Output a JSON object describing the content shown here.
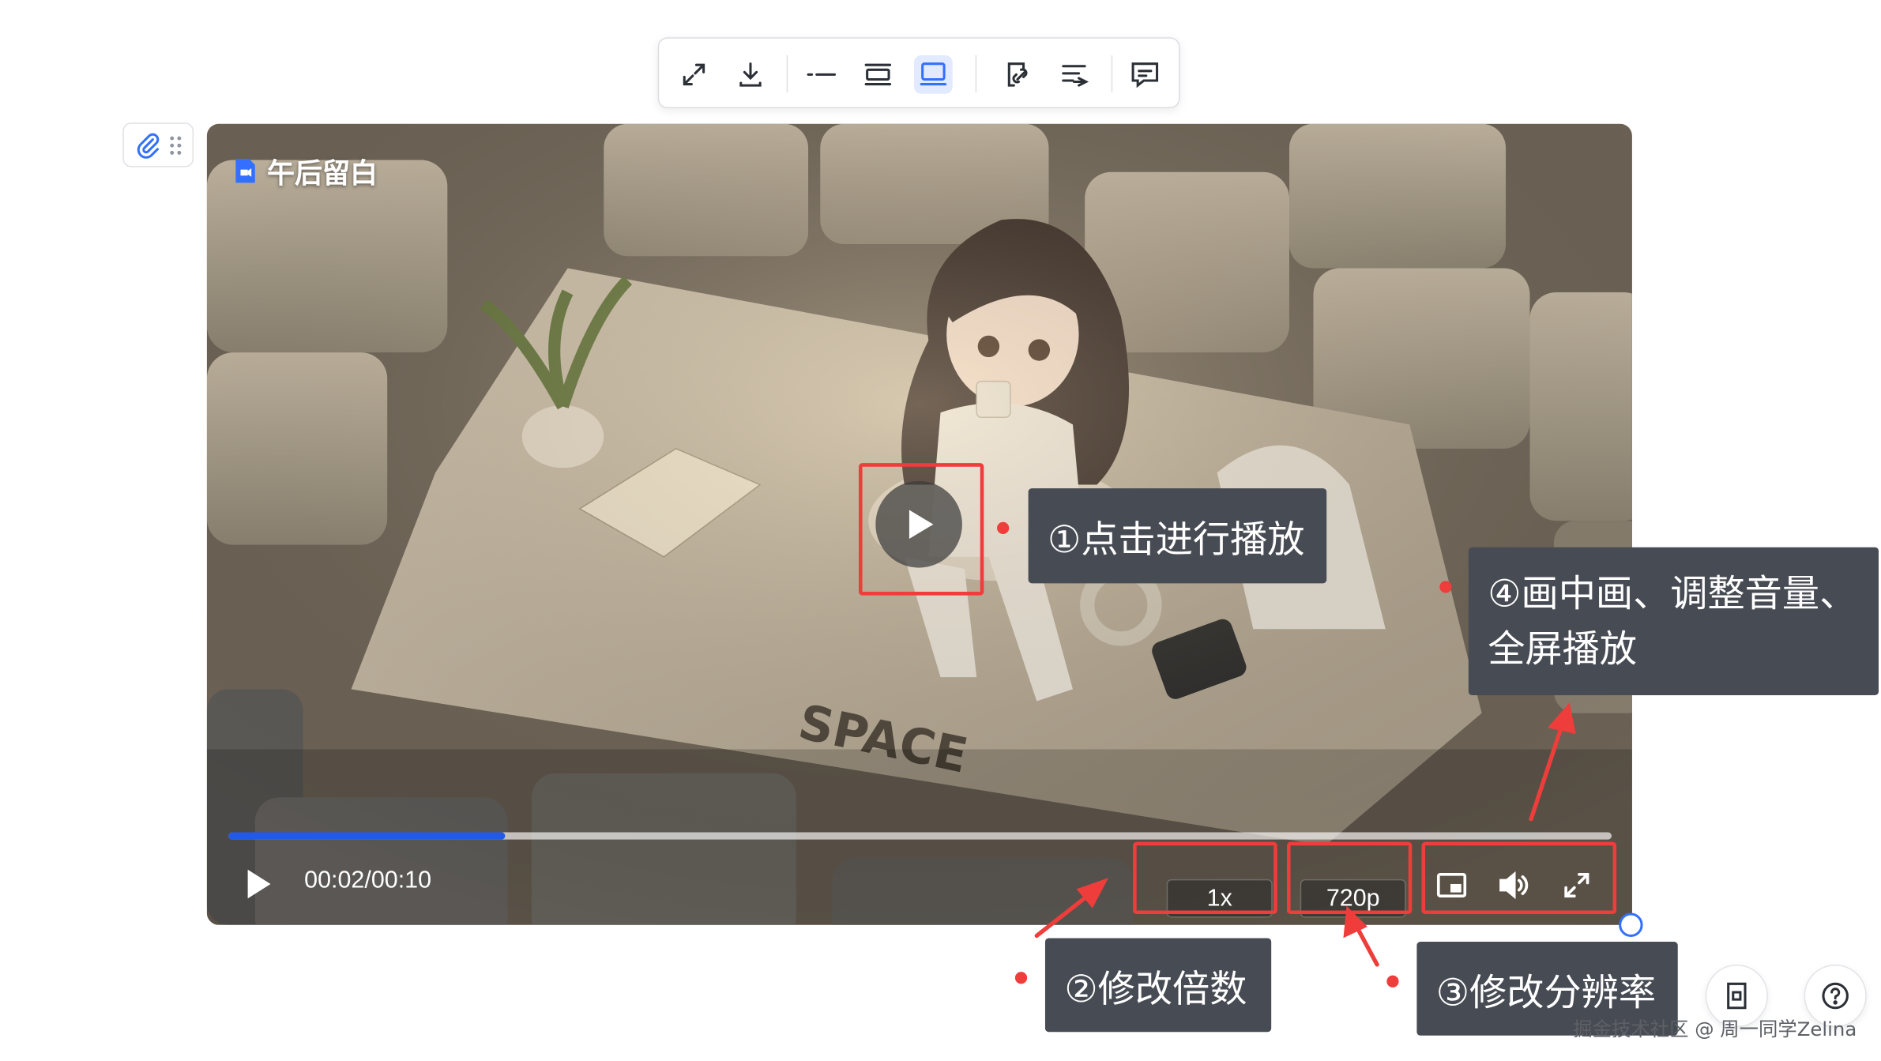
{
  "toolbar": {
    "buttons": [
      "expand-icon",
      "download-icon",
      "inline-layout-icon",
      "card-layout-icon",
      "preview-layout-icon",
      "link-icon",
      "wrap-text-icon",
      "comment-icon"
    ],
    "active_button": "preview-layout-icon",
    "accent_color": "#3370ff"
  },
  "video": {
    "title": "午后留白",
    "current_time": "00:02",
    "time_separator": "/",
    "duration": "00:10",
    "progress_fraction": 0.2,
    "speed": "1x",
    "quality": "720p",
    "progress_color": "#2159e8"
  },
  "callouts": {
    "play": "①点击进行播放",
    "pip_volume_fullscreen_line1": "④画中画、调整音量、",
    "pip_volume_fullscreen_line2": "全屏播放",
    "speed": "②修改倍数",
    "quality": "③修改分辨率"
  },
  "annotation_color": "#ee3d3b",
  "watermark": "掘金技术社区 @ 周一同学Zelina"
}
